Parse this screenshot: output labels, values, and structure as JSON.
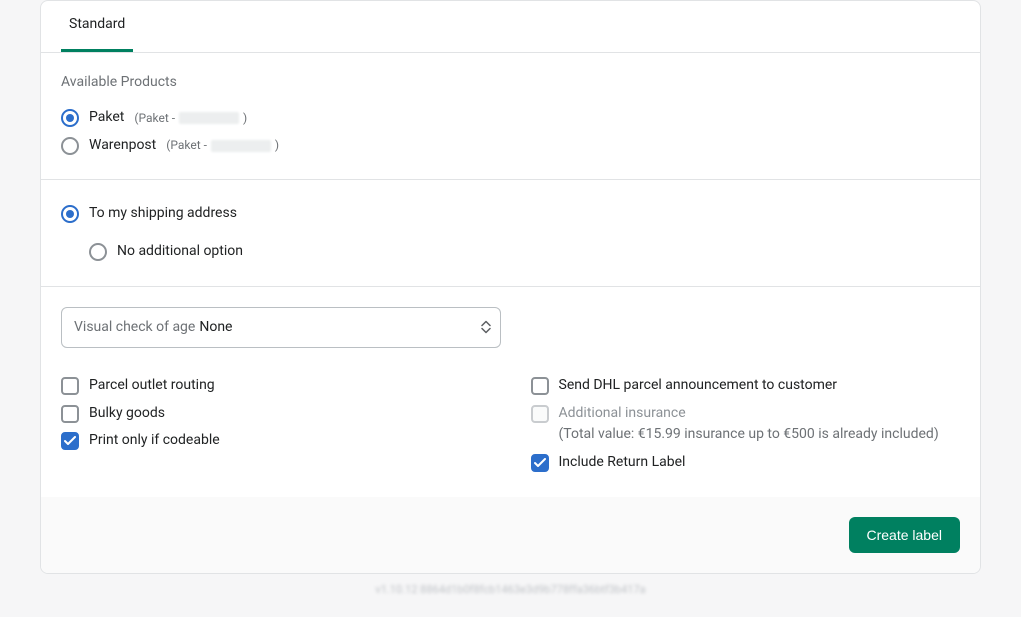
{
  "tabs": {
    "standard": "Standard"
  },
  "products": {
    "title": "Available Products",
    "items": [
      {
        "label": "Paket",
        "hint_prefix": "(Paket - ",
        "hint_suffix": ")"
      },
      {
        "label": "Warenpost",
        "hint_prefix": "(Paket - ",
        "hint_suffix": ")"
      }
    ]
  },
  "shipping": {
    "to_address": "To my shipping address",
    "no_additional": "No additional option"
  },
  "age_check": {
    "prefix": "Visual check of age",
    "value": "None"
  },
  "options": {
    "parcel_outlet": "Parcel outlet routing",
    "bulky_goods": "Bulky goods",
    "print_codeable": "Print only if codeable",
    "send_announcement": "Send DHL parcel announcement to customer",
    "additional_insurance": "Additional insurance",
    "insurance_note": "(Total value: €15.99 insurance up to €500 is already included)",
    "include_return": "Include Return Label"
  },
  "actions": {
    "create_label": "Create label"
  },
  "footer_meta": "v1.10.12 8864d1b0f8fcb1463e3d9b778ffa36btf3b417a"
}
